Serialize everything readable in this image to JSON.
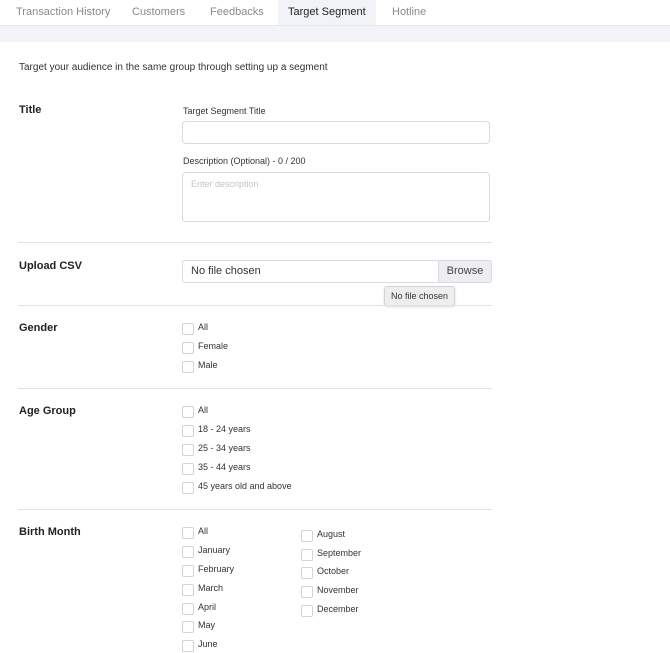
{
  "tabs": [
    "Transaction History",
    "Customers",
    "Feedbacks",
    "Target Segment",
    "Hotline"
  ],
  "active_tab": "Target Segment",
  "intro": "Target your audience in the same group through setting up a segment",
  "title_section": {
    "label": "Title",
    "segment_title_label": "Target Segment Title",
    "segment_title_value": "",
    "description_label": "Description (Optional) - 0 / 200",
    "description_placeholder": "Enter description"
  },
  "upload_section": {
    "label": "Upload CSV",
    "file_status": "No file chosen",
    "browse_label": "Browse",
    "tooltip": "No file chosen"
  },
  "gender_section": {
    "label": "Gender",
    "options": [
      "All",
      "Female",
      "Male"
    ]
  },
  "age_section": {
    "label": "Age Group",
    "options": [
      "All",
      "18 - 24 years",
      "25 - 34 years",
      "35 - 44 years",
      "45 years old and above"
    ]
  },
  "birth_month_section": {
    "label": "Birth Month",
    "options_col1": [
      "All",
      "January",
      "February",
      "March",
      "April",
      "May",
      "June"
    ],
    "options_col2": [
      "August",
      "September",
      "October",
      "November",
      "December"
    ]
  }
}
